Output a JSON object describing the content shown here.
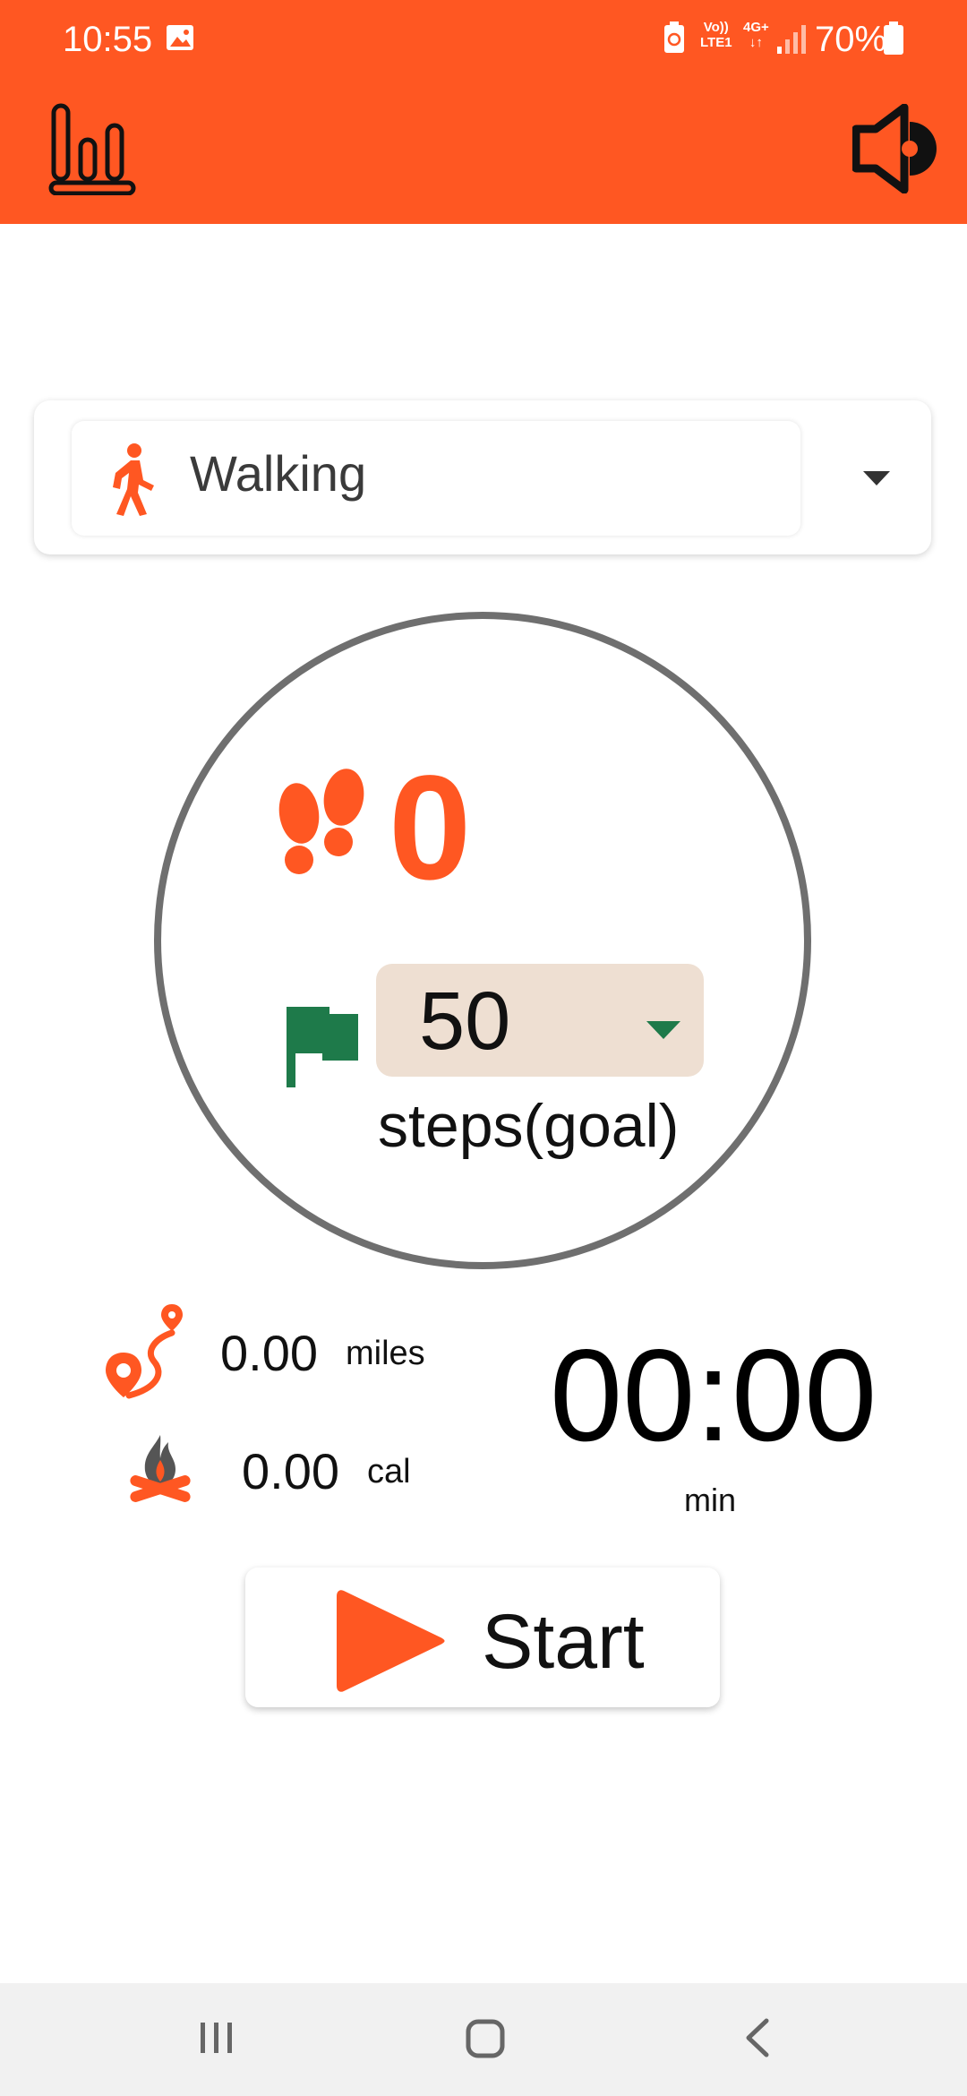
{
  "status_bar": {
    "time": "10:55",
    "net_top": "Vo))",
    "net_bottom": "LTE1",
    "net2_top": "4G+",
    "battery": "70%"
  },
  "icons": {
    "history": "bar-chart-history-icon",
    "sound": "speaker-icon",
    "activity": "walking-person-icon",
    "steps": "footprints-icon",
    "goal": "flag-icon",
    "distance": "route-pin-icon",
    "calories": "campfire-icon",
    "play": "play-icon"
  },
  "activity": {
    "selected": "Walking"
  },
  "steps": {
    "count": "0",
    "goal_value": "50",
    "goal_label": "steps(goal)"
  },
  "stats": {
    "distance_value": "0.00",
    "distance_unit": "miles",
    "calories_value": "0.00",
    "calories_unit": "cal",
    "timer": "00:00",
    "timer_unit": "min"
  },
  "start_label": "Start",
  "colors": {
    "accent": "#FF5722",
    "flag": "#1E7A4A",
    "goal_bg": "#EEDFD2",
    "ring": "#6f6f6f"
  }
}
